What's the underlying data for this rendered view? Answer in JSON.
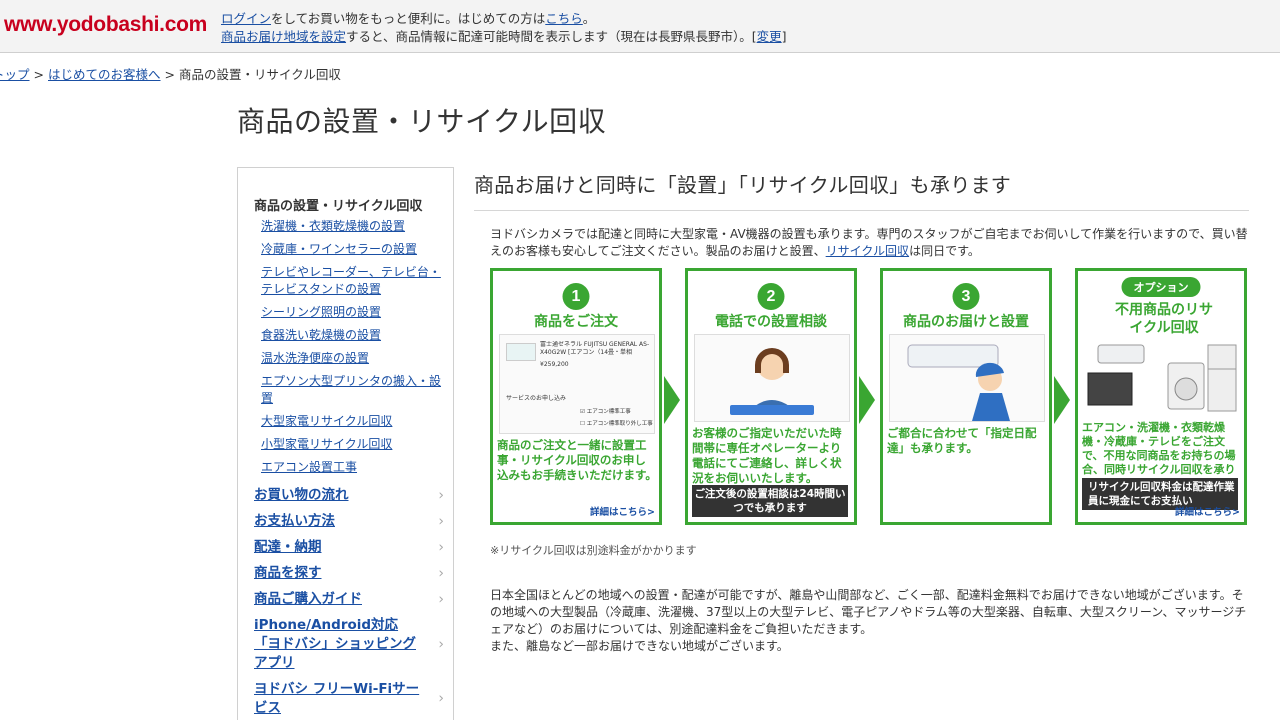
{
  "header": {
    "logo_main": "www.yodobashi",
    "logo_tld": ".com",
    "notice_line1_link": "ログイン",
    "notice_line1_mid": "をしてお買い物をもっと便利に。はじめての方は",
    "notice_line1_link2": "こちら",
    "notice_line1_end": "。",
    "notice_line2_link": "商品お届け地域を設定",
    "notice_line2_mid": "すると、商品情報に配達可能時間を表示します（現在は長野県長野市）。[",
    "notice_line2_link2": "変更",
    "notice_line2_end": "]"
  },
  "breadcrumb": {
    "items": [
      "トップ",
      "はじめてのお客様へ",
      "商品の設置・リサイクル回収"
    ],
    "sep": ">"
  },
  "page_title": "商品の設置・リサイクル回収",
  "sidebar": {
    "section_head": "商品の設置・リサイクル回収",
    "sub_items": [
      "洗濯機・衣類乾燥機の設置",
      "冷蔵庫・ワインセラーの設置",
      "テレビやレコーダー、テレビ台・テレビスタンドの設置",
      "シーリング照明の設置",
      "食器洗い乾燥機の設置",
      "温水洗浄便座の設置",
      "エプソン大型プリンタの搬入・設置",
      "大型家電リサイクル回収",
      "小型家電リサイクル回収",
      "エアコン設置工事"
    ],
    "main_items": [
      "お買い物の流れ",
      "お支払い方法",
      "配達・納期",
      "商品を探す",
      "商品ご購入ガイド",
      "iPhone/Android対応「ヨドバシ」ショッピングアプリ",
      "ヨドバシ フリーWi-Fiサービス"
    ],
    "chevron": "›"
  },
  "content": {
    "heading": "商品お届けと同時に「設置」「リサイクル回収」も承ります",
    "intro_a": "ヨドバシカメラでは配達と同時に大型家電・AV機器の設置も承ります。専門のスタッフがご自宅までお伺いして作業を行いますので、買い替えのお客様も安心してご注文ください。製品のお届けと設置、",
    "intro_link": "リサイクル回収",
    "intro_b": "は同日です。",
    "steps": [
      {
        "num": "1",
        "title": "商品をご注文",
        "illus_product": "富士通ゼネラル FUJITSU GENERAL AS-X40G2W [エアコン（14畳・単相200V）]",
        "illus_price": "¥259,200",
        "illus_service": "サービスのお申し込み",
        "illus_opt1": "エアコン標準工事",
        "illus_opt2": "エアコン標準取り外し工事",
        "desc": "商品のご注文と一緒に設置工事・リサイクル回収のお申し込みもお手続きいただけます。",
        "more": "詳細はこちら>"
      },
      {
        "num": "2",
        "title": "電話での設置相談",
        "desc": "お客様のご指定いただいた時間帯に専任オペレーターより電話にてご連絡し、詳しく状況をお伺いいたします。",
        "box": "ご注文後の設置相談は24時間いつでも承ります"
      },
      {
        "num": "3",
        "title": "商品のお届けと設置",
        "desc": "ご都合に合わせて「指定日配達」も承ります。"
      },
      {
        "badge": "オプション",
        "title": "不用商品のリサイクル回収",
        "desc": "エアコン・洗濯機・衣類乾燥機・冷蔵庫・テレビをご注文で、不用な同商品をお持ちの場合、同時リサイクル回収を承ります。",
        "box": "リサイクル回収料金は配達作業員に現金にてお支払い",
        "more": "詳細はこちら>"
      }
    ],
    "note": "※リサイクル回収は別途料金がかかります",
    "body_p1": "日本全国ほとんどの地域への設置・配達が可能ですが、離島や山間部など、ごく一部、配達料金無料でお届けできない地域がございます。その地域への大型製品（冷蔵庫、洗濯機、37型以上の大型テレビ、電子ピアノやドラム等の大型楽器、自転車、大型スクリーン、マッサージチェアなど）のお届けについては、別途配達料金をご負担いただきます。",
    "body_p2": "また、離島など一部お届けできない地域がございます。"
  },
  "colors": {
    "accent_green": "#3aa632",
    "link_blue": "#1a4fa3",
    "logo_red": "#c8001e"
  }
}
